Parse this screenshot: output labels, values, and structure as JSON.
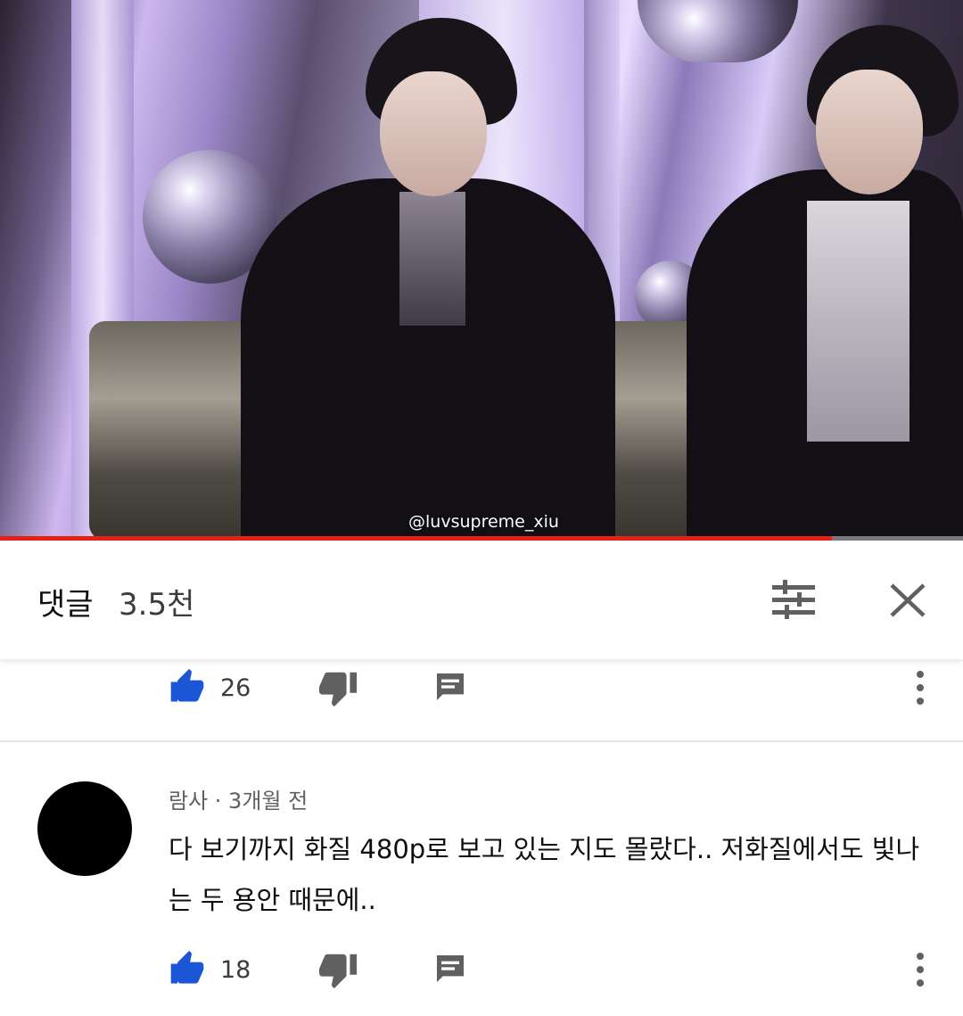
{
  "video": {
    "watermark": "@luvsupreme_xiu",
    "progress_fraction": 0.864
  },
  "comments_header": {
    "title": "댓글",
    "count": "3.5천",
    "sort_icon": "sort-sliders-icon",
    "close_icon": "close-icon"
  },
  "comments": [
    {
      "likes": "26"
    },
    {
      "author": "람사",
      "separator": "·",
      "time": "3개월 전",
      "meta": "람사 · 3개월 전",
      "text": "다 보기까지 화질 480p로 보고 있는 지도 몰랐다.. 저화질에서도 빛나는 두 용안 때문에..",
      "likes": "18"
    }
  ],
  "colors": {
    "progress": "#e62117",
    "like_icon": "#1a56d6",
    "icon_gray": "#606060"
  }
}
